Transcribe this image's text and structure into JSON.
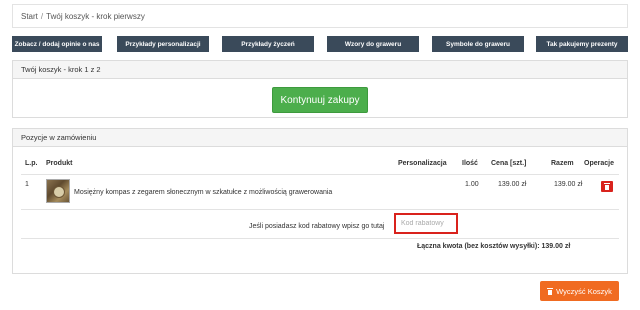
{
  "breadcrumb": {
    "home": "Start",
    "separator": "/",
    "current": "Twój koszyk - krok pierwszy"
  },
  "nav": [
    "Zobacz / dodaj opinie o nas",
    "Przykłady personalizacji",
    "Przykłady życzeń",
    "Wzory do graweru",
    "Symbole do graweru",
    "Tak pakujemy prezenty"
  ],
  "step_panel": {
    "title": "Twój koszyk - krok 1 z 2",
    "continue_label": "Kontynuuj zakupy"
  },
  "order_panel": {
    "title": "Pozycje w zamówieniu",
    "columns": [
      "L.p.",
      "Produkt",
      "Personalizacja",
      "Ilość",
      "Cena [szt.]",
      "Razem",
      "Operacje"
    ],
    "rows": [
      {
        "lp": "1",
        "product": "Mosiężny kompas z zegarem słonecznym w szkatułce z możliwością grawerowania",
        "qty": "1.00",
        "price": "139.00 zł",
        "total": "139.00 zł"
      }
    ],
    "coupon_label": "Jeśli posiadasz kod rabatowy wpisz go tutaj",
    "coupon_placeholder": "Kod rabatowy",
    "grand_total": "Łączna kwota (bez kosztów wysyłki): 139.00 zł"
  },
  "clear_cart_label": "Wyczyść Koszyk",
  "colors": {
    "nav_bg": "#3a4a5a",
    "continue_green": "#4cae4c",
    "delete_red": "#d9231d",
    "clear_orange": "#f06b21",
    "coupon_border": "#d9221c"
  },
  "icons": {
    "delete": "trash-icon",
    "clear": "trash-icon"
  }
}
